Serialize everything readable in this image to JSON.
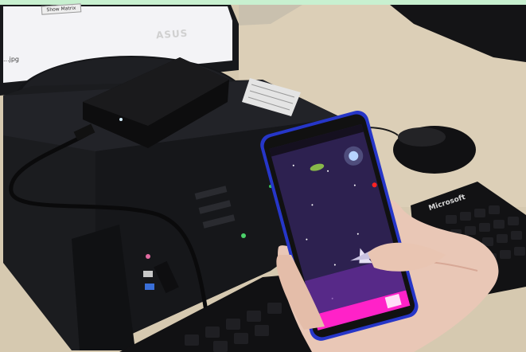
{
  "monitor": {
    "brand": "ASUS",
    "screen_button_label": "Show Matrix",
    "screen_file_label": "...jpg"
  },
  "keyboard": {
    "brand": "Microsoft"
  },
  "colors": {
    "desk": "#d9cdb6",
    "pc_case": "#1b1c1f",
    "phone_frame": "#2a3bd6",
    "game_bg": "#2d2150",
    "game_bar": "#ff22c8",
    "highlight_strip": "#c8f0d0"
  }
}
